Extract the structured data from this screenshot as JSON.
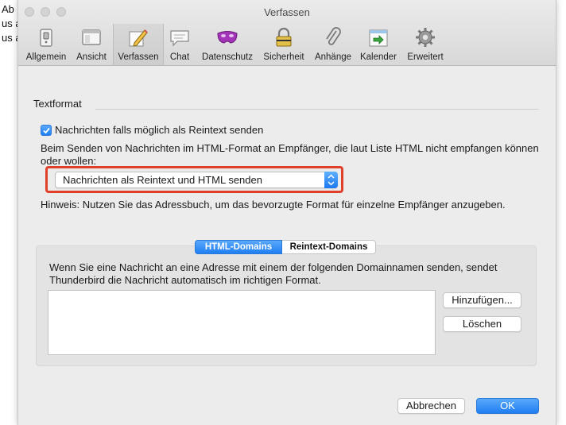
{
  "background_window": {
    "lines": [
      "Ab",
      "us a",
      "us a"
    ]
  },
  "window": {
    "title": "Verfassen"
  },
  "toolbar": {
    "items": [
      {
        "label": "Allgemein",
        "icon": "general-switch-icon"
      },
      {
        "label": "Ansicht",
        "icon": "window-view-icon"
      },
      {
        "label": "Verfassen",
        "icon": "compose-pencil-icon",
        "selected": true
      },
      {
        "label": "Chat",
        "icon": "chat-bubble-icon"
      },
      {
        "label": "Datenschutz",
        "icon": "privacy-mask-icon"
      },
      {
        "label": "Sicherheit",
        "icon": "security-lock-icon"
      },
      {
        "label": "Anhänge",
        "icon": "paperclip-icon"
      },
      {
        "label": "Kalender",
        "icon": "calendar-icon"
      },
      {
        "label": "Erweitert",
        "icon": "gear-icon"
      }
    ]
  },
  "textformat": {
    "section_title": "Textformat",
    "checkbox_label": "Nachrichten falls möglich als Reintext senden",
    "checkbox_checked": true,
    "description": "Beim Senden von Nachrichten im HTML-Format an Empfänger, die laut Liste HTML nicht empfangen können oder wollen:",
    "select_value": "Nachrichten als Reintext und HTML senden",
    "hint": "Hinweis: Nutzen Sie das Adressbuch, um das bevorzugte Format für einzelne Empfänger anzugeben."
  },
  "domains": {
    "tabs": [
      {
        "label": "HTML-Domains",
        "selected": true
      },
      {
        "label": "Reintext-Domains",
        "selected": false
      }
    ],
    "description": "Wenn Sie eine Nachricht an eine Adresse mit einem der folgenden Domainnamen senden, sendet Thunderbird die Nachricht automatisch im richtigen Format.",
    "items": [],
    "add_button": "Hinzufügen...",
    "delete_button": "Löschen"
  },
  "footer": {
    "cancel_button": "Abbrechen",
    "ok_button": "OK"
  },
  "colors": {
    "accent": "#1f7ef2",
    "highlight_annotation": "#e0402a",
    "window_bg": "#ececec"
  }
}
